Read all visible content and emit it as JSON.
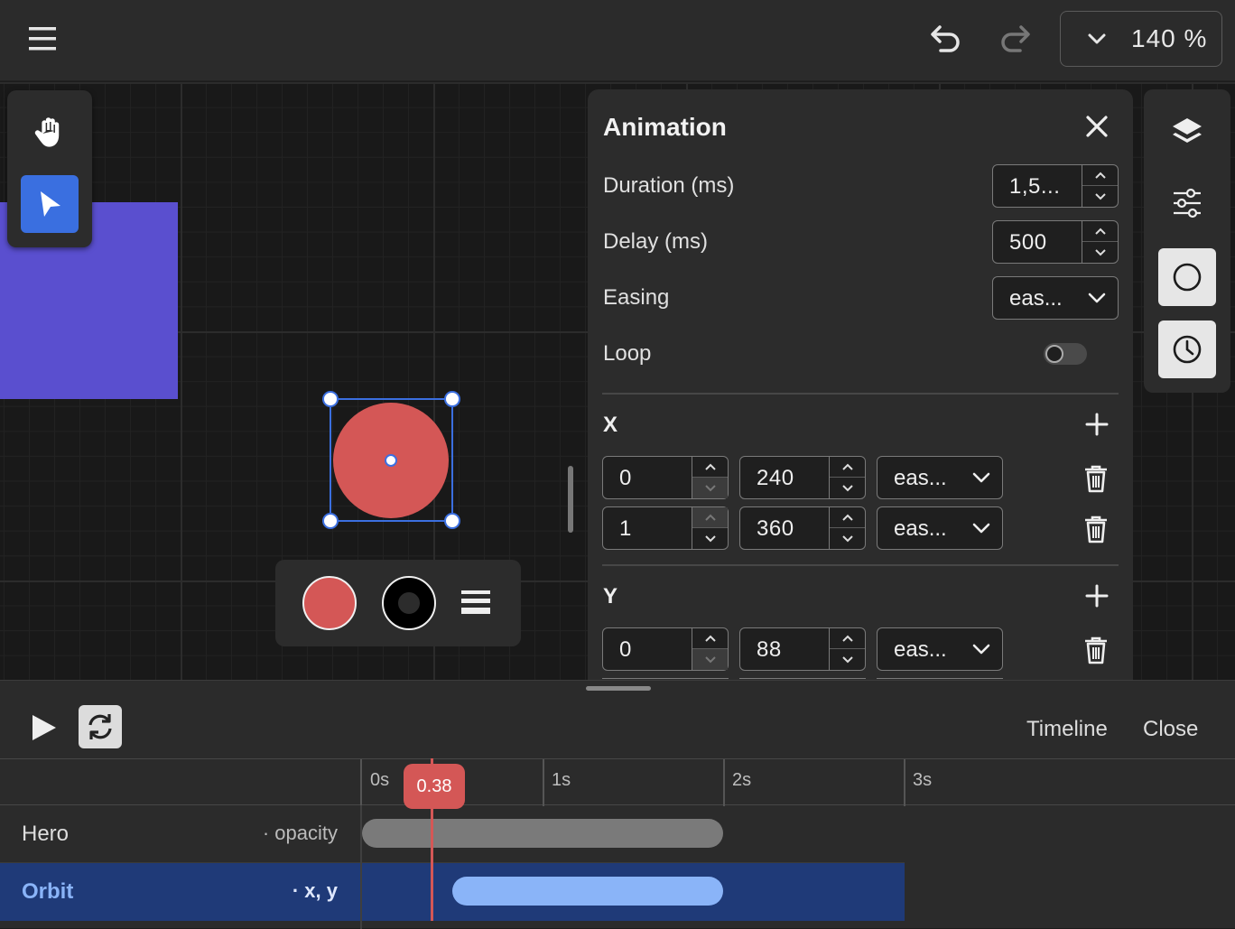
{
  "topbar": {
    "zoom_value": "140 %",
    "icons": [
      "hamburger-menu-icon",
      "undo-icon",
      "redo-icon",
      "chevron-down-icon"
    ]
  },
  "tools": {
    "icons": [
      "hand-icon",
      "pointer-icon"
    ]
  },
  "canvas": {
    "rect_color": "#5a4fcf",
    "circle_color": "#d45756",
    "selection_color": "#3b6fe0"
  },
  "shape_toolbar": {
    "fill_color": "#d45756",
    "icons": [
      "fill-swatch-icon",
      "stroke-swatch-icon",
      "stroke-width-icon"
    ]
  },
  "animation_panel": {
    "title": "Animation",
    "duration_label": "Duration (ms)",
    "duration_value": "1,5...",
    "delay_label": "Delay (ms)",
    "delay_value": "500",
    "easing_label": "Easing",
    "easing_value": "eas...",
    "loop_label": "Loop",
    "loop_on": false,
    "sections": [
      {
        "name": "X",
        "keyframes": [
          {
            "time": "0",
            "value": "240",
            "easing": "eas..."
          },
          {
            "time": "1",
            "value": "360",
            "easing": "eas..."
          }
        ]
      },
      {
        "name": "Y",
        "keyframes": [
          {
            "time": "0",
            "value": "88",
            "easing": "eas..."
          }
        ]
      }
    ]
  },
  "side_rail": {
    "icons": [
      "layers-icon",
      "sliders-icon",
      "circle-shape-icon",
      "clock-icon"
    ]
  },
  "timeline": {
    "title": "Timeline",
    "close_label": "Close",
    "ticks": [
      "0s",
      "1s",
      "2s",
      "3s"
    ],
    "playhead": "0.38",
    "playhead_color": "#d45756",
    "rows": [
      {
        "name": "Hero",
        "props": "· opacity",
        "bar_color": "#7a7a7a",
        "selected": false
      },
      {
        "name": "Orbit",
        "props": "· x, y",
        "bar_color": "#8ab4f8",
        "selected": true
      }
    ]
  }
}
